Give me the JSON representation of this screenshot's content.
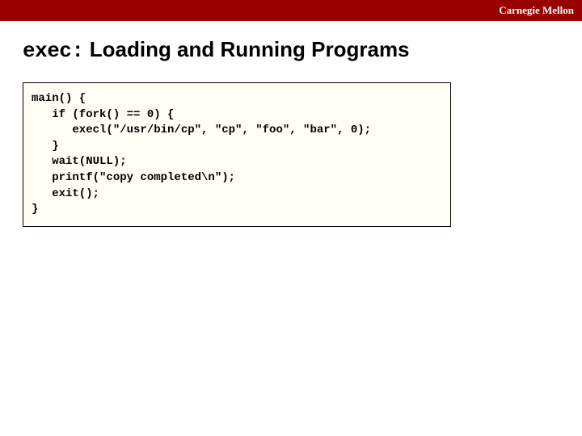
{
  "header": {
    "brand": "Carnegie Mellon"
  },
  "title": {
    "mono": "exec:",
    "rest": " Loading and Running Programs"
  },
  "code": "main() {\n   if (fork() == 0) {\n      execl(\"/usr/bin/cp\", \"cp\", \"foo\", \"bar\", 0);\n   }\n   wait(NULL);\n   printf(\"copy completed\\n\");\n   exit();\n}"
}
